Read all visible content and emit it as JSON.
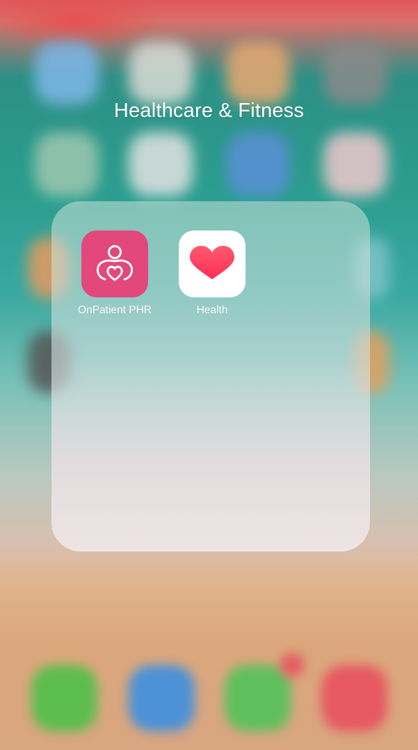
{
  "folder": {
    "title": "Healthcare & Fitness",
    "apps": [
      {
        "label": "OnPatient PHR",
        "icon": "person-heart-icon",
        "icon_bg": "#e2487c"
      },
      {
        "label": "Health",
        "icon": "heart-icon",
        "icon_bg": "#ffffff",
        "accent": "#ff3b5c"
      }
    ]
  },
  "dock": {
    "apps": [
      {
        "icon": "phone-icon",
        "color": "#4fc04a"
      },
      {
        "icon": "safari-icon",
        "color": "#3d8fe0"
      },
      {
        "icon": "messages-icon",
        "color": "#52c35a"
      },
      {
        "icon": "music-icon",
        "color": "#e8505f"
      }
    ]
  }
}
